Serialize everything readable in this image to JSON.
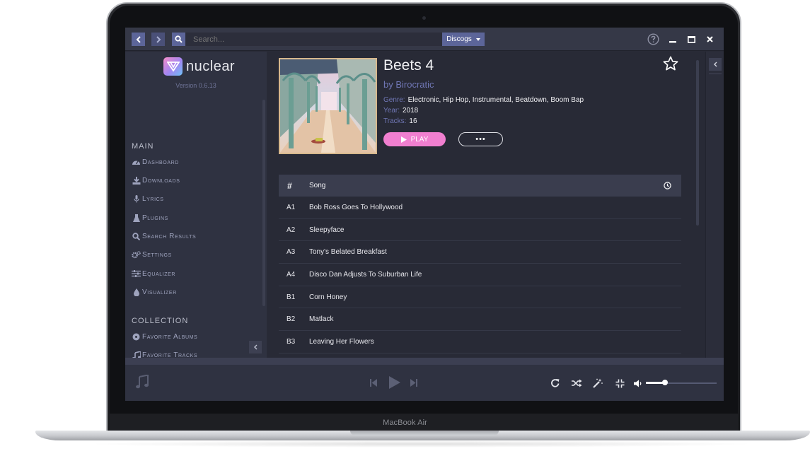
{
  "device": {
    "label": "MacBook Air"
  },
  "topbar": {
    "back_icon": "chevron-left",
    "forward_icon": "chevron-right",
    "search_placeholder": "Search...",
    "search_source": "Discogs",
    "help_icon": "question-circle",
    "minimize_icon": "minimize",
    "maximize_icon": "maximize",
    "close_icon": "close"
  },
  "sidebar": {
    "app_name": "nuclear",
    "version": "Version 0.6.13",
    "main_header": "MAIN",
    "main_items": [
      {
        "label": "Dashboard",
        "icon": "dashboard-icon"
      },
      {
        "label": "Downloads",
        "icon": "download-icon"
      },
      {
        "label": "Lyrics",
        "icon": "microphone-icon"
      },
      {
        "label": "Plugins",
        "icon": "flask-icon"
      },
      {
        "label": "Search Results",
        "icon": "search-icon"
      },
      {
        "label": "Settings",
        "icon": "cogs-icon"
      },
      {
        "label": "Equalizer",
        "icon": "sliders-icon"
      },
      {
        "label": "Visualizer",
        "icon": "tint-icon"
      }
    ],
    "collection_header": "COLLECTION",
    "collection_items": [
      {
        "label": "Favorite Albums",
        "icon": "record-icon"
      },
      {
        "label": "Favorite Tracks",
        "icon": "music-icon"
      }
    ]
  },
  "album": {
    "title": "Beets 4",
    "artist": "by Birocratic",
    "genre_label": "Genre:",
    "genre": "Electronic, Hip Hop, Instrumental, Beatdown, Boom Bap",
    "year_label": "Year:",
    "year": "2018",
    "tracks_label": "Tracks:",
    "tracks_count": "16",
    "play_label": "PLAY",
    "more_label": "•••"
  },
  "tracklist": {
    "header_num": "#",
    "header_song": "Song",
    "rows": [
      {
        "num": "A1",
        "song": "Bob Ross Goes To Hollywood"
      },
      {
        "num": "A2",
        "song": "Sleepyface"
      },
      {
        "num": "A3",
        "song": "Tony's Belated Breakfast"
      },
      {
        "num": "A4",
        "song": "Disco Dan Adjusts To Suburban Life"
      },
      {
        "num": "B1",
        "song": "Corn Honey"
      },
      {
        "num": "B2",
        "song": "Matlack"
      },
      {
        "num": "B3",
        "song": "Leaving Her Flowers"
      }
    ]
  },
  "player": {
    "volume_fraction": 0.27
  },
  "colors": {
    "accent": "#5c6599",
    "play_button": "#f17fd0",
    "artist_link": "#6f76b4",
    "background": "#282a36",
    "sidebar": "#2f3241"
  }
}
